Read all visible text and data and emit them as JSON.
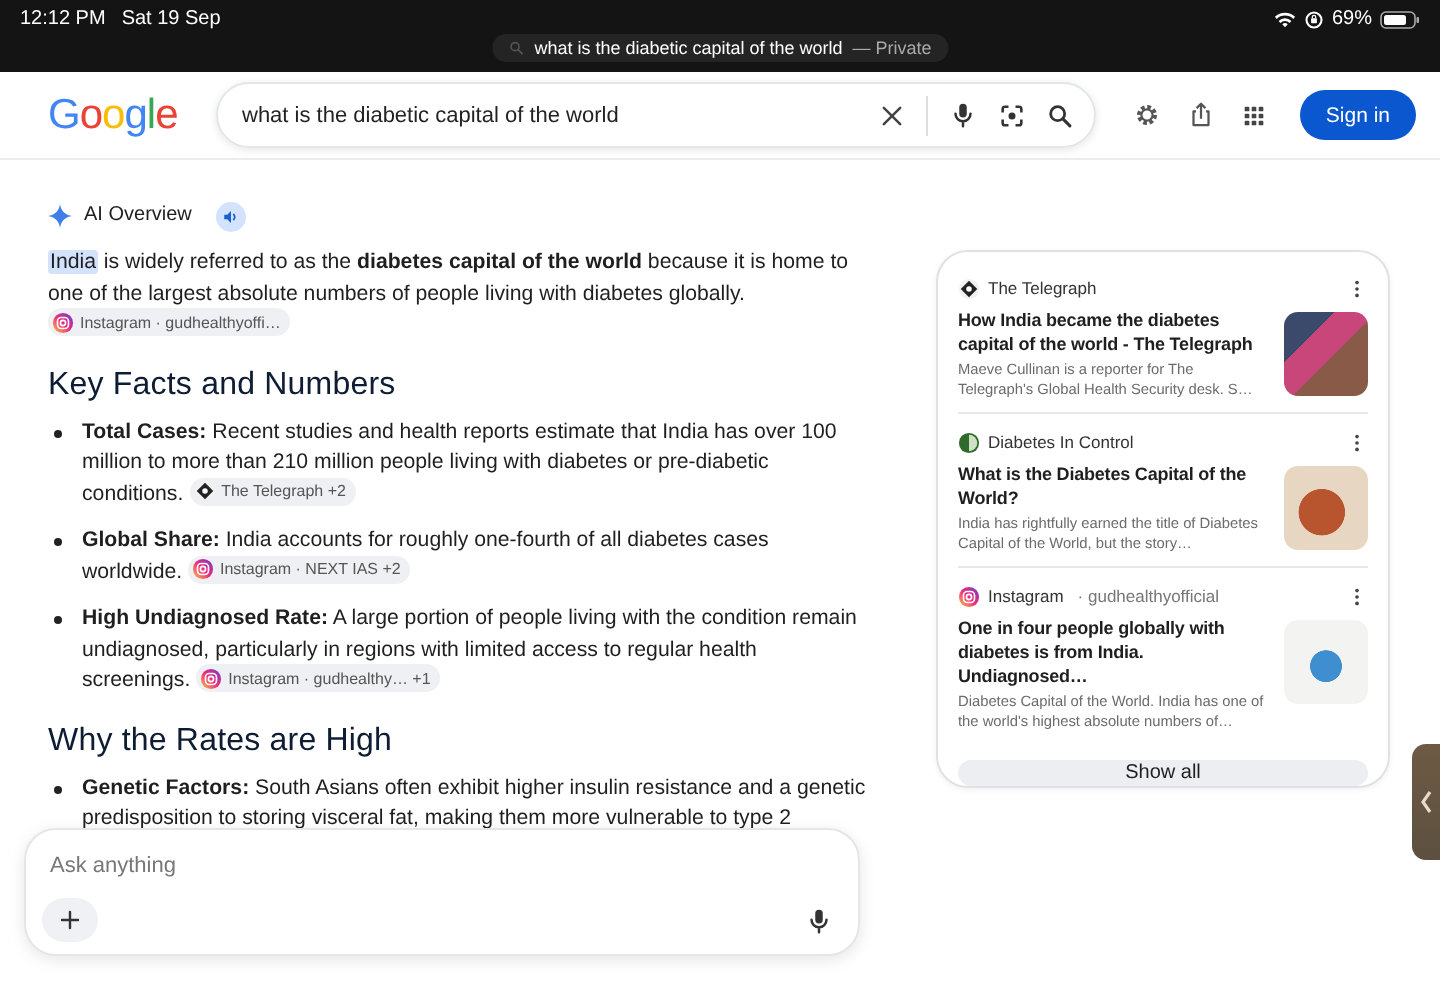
{
  "status_bar": {
    "time": "12:12 PM",
    "date": "Sat 19 Sep",
    "url_pill": {
      "query": "what is the diabetic capital of the world",
      "suffix": "— Private"
    },
    "battery": "69%"
  },
  "header": {
    "logo": "Google",
    "search": {
      "value": "what is the diabetic capital of the world"
    },
    "sign_in": "Sign in"
  },
  "ai_overview": {
    "label": "AI Overview",
    "intro": {
      "highlight": "India",
      "text": "is widely referred to as the **diabetes capital of the world** because it is home to one of the largest absolute numbers of people living with diabetes globally.",
      "source": {
        "kind": "camera",
        "label": "Instagram · gudhealthyoffi…"
      }
    },
    "sections": [
      {
        "heading": "Key Facts and Numbers",
        "bullets": [
          {
            "text": "**Total Cases:** Recent studies and health reports estimate that India has over 100 million to more than 210 million people living with diabetes or pre-diabetic conditions.",
            "source": {
              "kind": "emblem",
              "label": "The Telegraph +2"
            }
          },
          {
            "text": "**Global Share:** India accounts for roughly one-fourth of all diabetes cases worldwide.",
            "source": {
              "kind": "camera",
              "label": "Instagram · NEXT IAS +2"
            }
          },
          {
            "text": "**High Undiagnosed Rate:** A large portion of people living with the condition remain undiagnosed, particularly in regions with limited access to regular health screenings.",
            "source": {
              "kind": "camera",
              "label": "Instagram · gudhealthy… +1"
            }
          }
        ]
      },
      {
        "heading": "Why the Rates are High",
        "bullets": [
          {
            "text": "**Genetic Factors:** South Asians often exhibit higher insulin resistance and a genetic predisposition to storing visceral fat, making them more vulnerable to type 2"
          }
        ]
      }
    ]
  },
  "sources": {
    "items": [
      {
        "kind": "emblem",
        "site": "The Telegraph",
        "title": "How India became the diabetes capital of the world - The Telegraph",
        "snippet": "Maeve Cullinan is a reporter for The Telegraph's Global Health Security desk. S…"
      },
      {
        "kind": "circle",
        "site": "Diabetes In Control",
        "title": "What is the Diabetes Capital of the World?",
        "snippet": "India has rightfully earned the title of Diabetes Capital of the World, but the story…"
      },
      {
        "kind": "camera",
        "site": "Instagram",
        "handle": "· gudhealthyofficial",
        "title": "One in four people globally with diabetes is from India. Undiagnosed…",
        "snippet": "Diabetes Capital of the World. India has one of the world's highest absolute numbers of…"
      }
    ],
    "show_all": "Show all"
  },
  "ask_box": {
    "placeholder": "Ask anything"
  }
}
